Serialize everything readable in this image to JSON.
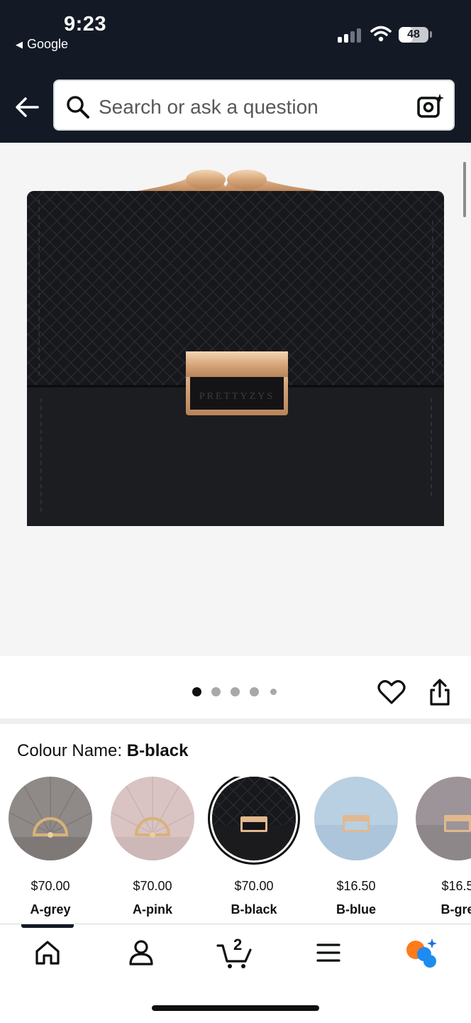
{
  "status_bar": {
    "time": "9:23",
    "back_app": "Google",
    "battery": "48",
    "battery_level": 0.48
  },
  "search": {
    "placeholder": "Search or ask a question"
  },
  "product_image": {
    "brand_text": "PRETTYZYS",
    "carousel_count": 5,
    "carousel_active": 0
  },
  "colour": {
    "label": "Colour Name:",
    "selected": "B-black"
  },
  "swatches": [
    {
      "price": "$70.00",
      "name": "A-grey",
      "color": "#8f8a87"
    },
    {
      "price": "$70.00",
      "name": "A-pink",
      "color": "#d9c3c3"
    },
    {
      "price": "$70.00",
      "name": "B-black",
      "color": "#1b1b1d"
    },
    {
      "price": "$16.50",
      "name": "B-blue",
      "color": "#b9cfe2"
    },
    {
      "price": "$16.5",
      "name": "B-gre",
      "color": "#9c9498"
    }
  ],
  "bottom_nav": {
    "cart_count": "2",
    "items": [
      "home-icon",
      "account-icon",
      "cart-icon",
      "menu-icon",
      "ai-assistant-icon"
    ]
  },
  "colors": {
    "header_bg": "#131a26",
    "accent_orange": "#ff7a1a",
    "accent_blue": "#1d8bf0"
  }
}
